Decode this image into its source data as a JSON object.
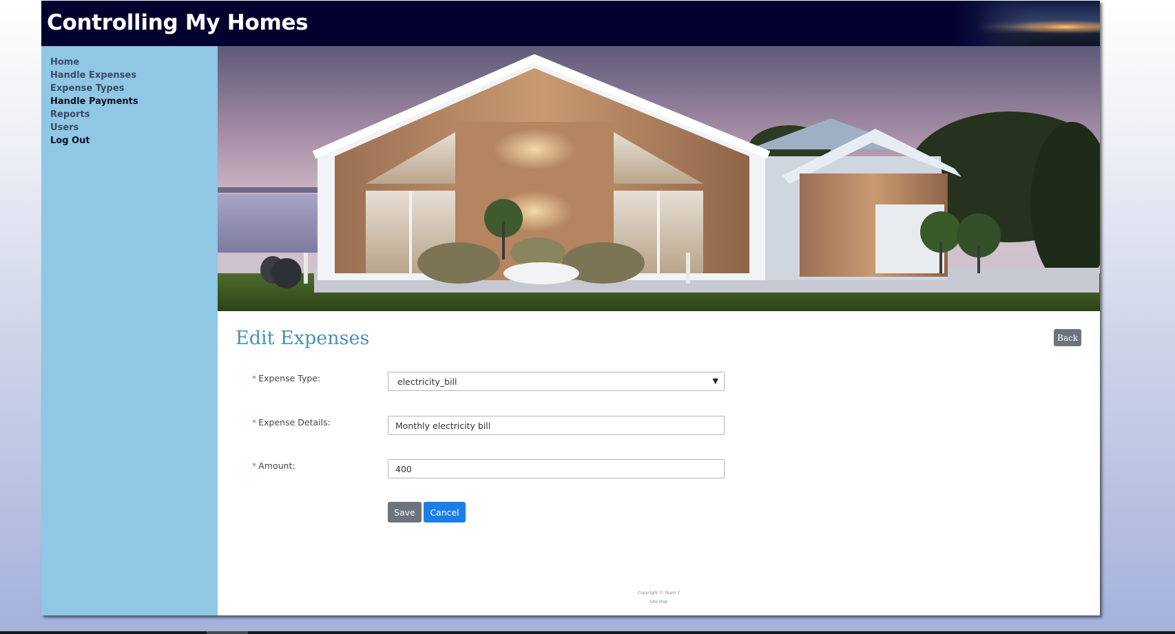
{
  "app": {
    "title": "Controlling My Homes"
  },
  "nav": {
    "items": [
      {
        "label": "Home"
      },
      {
        "label": "Handle Expenses"
      },
      {
        "label": "Expense Types"
      },
      {
        "label": "Handle Payments"
      },
      {
        "label": "Reports"
      },
      {
        "label": "Users"
      },
      {
        "label": "Log Out"
      }
    ]
  },
  "page": {
    "title": "Edit Expenses",
    "back_label": "Back"
  },
  "form": {
    "required_marker": "*",
    "expense_type": {
      "label": "Expense Type:",
      "value": "electricity_bill"
    },
    "expense_details": {
      "label": "Expense Details:",
      "value": "Monthly electricity bill"
    },
    "amount": {
      "label": "Amount:",
      "value": "400"
    },
    "save_label": "Save",
    "cancel_label": "Cancel"
  },
  "footer": {
    "copyright": "Copyright © Team 7",
    "sitemap": "Site Map"
  },
  "colors": {
    "header_bg": "#03022f",
    "sidebar_bg": "#8fc7e4",
    "title_color": "#4a8fbd",
    "save_button": "#6b737c",
    "cancel_button": "#1a7ee8",
    "required_marker": "#d9534f"
  },
  "icons": {
    "select_arrow": "chevron-down-icon"
  }
}
